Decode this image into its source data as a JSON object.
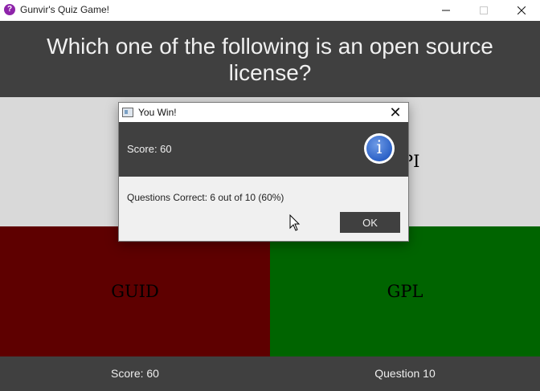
{
  "window": {
    "title": "Gunvir's Quiz Game!",
    "app_icon_glyph": "?"
  },
  "question": {
    "text": "Which one of the following is an open source license?"
  },
  "answers": {
    "top_partial_label": "PI",
    "guid": "GUID",
    "gpl": "GPL"
  },
  "footer": {
    "score": "Score: 60",
    "question": "Question 10"
  },
  "dialog": {
    "title": "You Win!",
    "score": "Score: 60",
    "message": "Questions Correct: 6 out of 10 (60%)",
    "ok_label": "OK",
    "info_glyph": "i",
    "close_glyph": "✕"
  },
  "colors": {
    "header_bg": "#404040",
    "wrong_answer": "#5e0000",
    "correct_answer": "#006400",
    "neutral_answer": "#d9d9d9"
  }
}
